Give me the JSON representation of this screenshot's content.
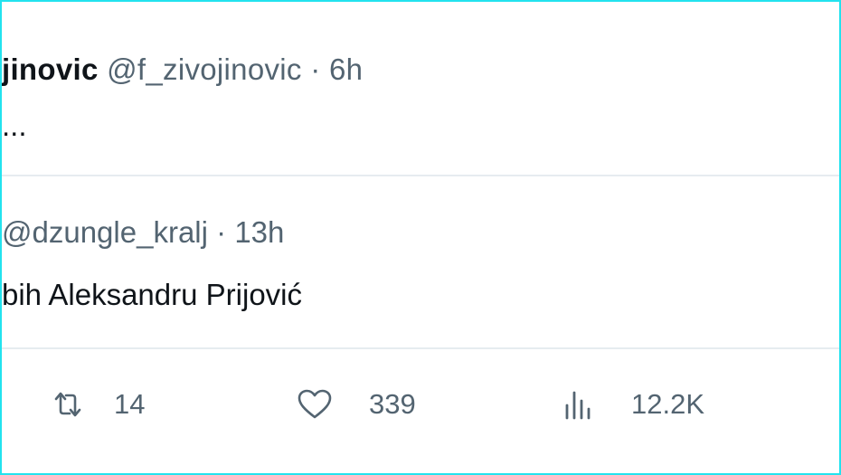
{
  "tweet": {
    "name": "jinovic",
    "handle": "@f_zivojinovic",
    "separator": "·",
    "time": "6h",
    "text": "..."
  },
  "quoted_tweet": {
    "handle": "@dzungle_kralj",
    "separator": "·",
    "time": "13h",
    "text": "bih Aleksandru Prijović"
  },
  "actions": {
    "retweets": "14",
    "likes": "339",
    "views": "12.2K"
  },
  "icons": {
    "retweet": "retweet-icon",
    "like": "heart-icon",
    "views": "views-icon"
  },
  "colors": {
    "frame_border": "#22e3ee",
    "text": "#0f1419",
    "secondary_text": "#536471",
    "divider": "#e6ecf0"
  }
}
